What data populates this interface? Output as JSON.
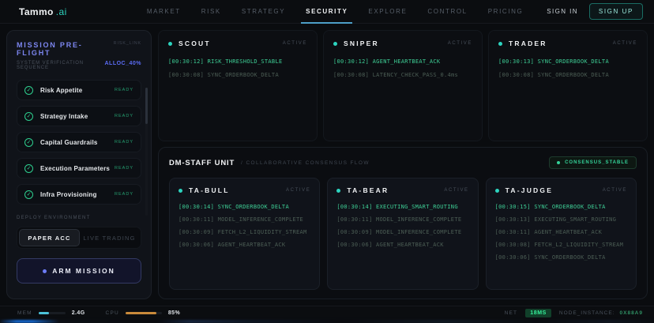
{
  "brand": {
    "name": "Tammo",
    "suffix": ".ai"
  },
  "nav": {
    "items": [
      {
        "label": "MARKET"
      },
      {
        "label": "RISK"
      },
      {
        "label": "STRATEGY"
      },
      {
        "label": "SECURITY",
        "active": true
      },
      {
        "label": "EXPLORE"
      },
      {
        "label": "CONTROL"
      },
      {
        "label": "PRICING"
      }
    ],
    "sign_in": "SIGN IN",
    "sign_up": "SIGN UP"
  },
  "sidebar": {
    "title": "MISSION PRE-FLIGHT",
    "risk_link": "RISK_LINK",
    "subtitle": "SYSTEM VERIFICATION SEQUENCE",
    "alloc": "ALLOC_40%",
    "check_glyph": "✓",
    "checklist": [
      {
        "label": "Risk Appetite",
        "status": "READY"
      },
      {
        "label": "Strategy Intake",
        "status": "READY"
      },
      {
        "label": "Capital Guardrails",
        "status": "READY"
      },
      {
        "label": "Execution Parameters",
        "status": "READY"
      },
      {
        "label": "Infra Provisioning",
        "status": "READY"
      }
    ],
    "deploy_label": "DEPLOY ENVIRONMENT",
    "env_options": [
      {
        "label": "PAPER ACC",
        "active": true
      },
      {
        "label": "LIVE TRADING",
        "active": false
      }
    ],
    "arm_button": "ARM MISSION"
  },
  "agents": [
    {
      "name": "SCOUT",
      "status": "ACTIVE",
      "logs": [
        {
          "time": "[00:30:12]",
          "msg": "RISK_THRESHOLD_STABLE"
        },
        {
          "time": "[00:30:08]",
          "msg": "SYNC_ORDERBOOK_DELTA"
        }
      ]
    },
    {
      "name": "SNIPER",
      "status": "ACTIVE",
      "logs": [
        {
          "time": "[00:30:12]",
          "msg": "AGENT_HEARTBEAT_ACK"
        },
        {
          "time": "[00:30:08]",
          "msg": "LATENCY_CHECK_PASS_0.4ms"
        }
      ]
    },
    {
      "name": "TRADER",
      "status": "ACTIVE",
      "logs": [
        {
          "time": "[00:30:13]",
          "msg": "SYNC_ORDERBOOK_DELTA"
        },
        {
          "time": "[00:30:08]",
          "msg": "SYNC_ORDERBOOK_DELTA"
        }
      ]
    }
  ],
  "staff_unit": {
    "title": "DM-STAFF UNIT",
    "subtitle": "/ COLLABORATIVE CONSENSUS FLOW",
    "badge": "CONSENSUS_STABLE",
    "agents": [
      {
        "name": "TA-BULL",
        "status": "ACTIVE",
        "logs": [
          {
            "time": "[00:30:14]",
            "msg": "SYNC_ORDERBOOK_DELTA"
          },
          {
            "time": "[00:30:11]",
            "msg": "MODEL_INFERENCE_COMPLETE"
          },
          {
            "time": "[00:30:09]",
            "msg": "FETCH_L2_LIQUIDITY_STREAM"
          },
          {
            "time": "[00:30:06]",
            "msg": "AGENT_HEARTBEAT_ACK"
          }
        ]
      },
      {
        "name": "TA-BEAR",
        "status": "ACTIVE",
        "logs": [
          {
            "time": "[00:30:14]",
            "msg": "EXECUTING_SMART_ROUTING"
          },
          {
            "time": "[00:30:11]",
            "msg": "MODEL_INFERENCE_COMPLETE"
          },
          {
            "time": "[00:30:09]",
            "msg": "MODEL_INFERENCE_COMPLETE"
          },
          {
            "time": "[00:30:06]",
            "msg": "AGENT_HEARTBEAT_ACK"
          }
        ]
      },
      {
        "name": "TA-JUDGE",
        "status": "ACTIVE",
        "logs": [
          {
            "time": "[00:30:15]",
            "msg": "SYNC_ORDERBOOK_DELTA"
          },
          {
            "time": "[00:30:13]",
            "msg": "EXECUTING_SMART_ROUTING"
          },
          {
            "time": "[00:30:11]",
            "msg": "AGENT_HEARTBEAT_ACK"
          },
          {
            "time": "[00:30:08]",
            "msg": "FETCH_L2_LIQUIDITY_STREAM"
          },
          {
            "time": "[00:30:06]",
            "msg": "SYNC_ORDERBOOK_DELTA"
          }
        ]
      }
    ]
  },
  "status_bar": {
    "mem_label": "MEM",
    "mem_value": "2.4G",
    "mem_pct": 38,
    "cpu_label": "CPU",
    "cpu_value": "85%",
    "cpu_pct": 85,
    "net_label": "NET",
    "net_value": "18MS",
    "node_label": "NODE_INSTANCE:",
    "node_value": "0X88A9"
  },
  "colors": {
    "accent_teal": "#2dd4bf",
    "accent_indigo": "#6d7cf5",
    "status_green": "#2ecf8f",
    "log_bright": "#3ecf96",
    "log_dim": "#4c5e55",
    "cpu_amber": "#c98a3b",
    "mem_cyan": "#4cc3d9",
    "nav_underline": "#4d9fc7"
  }
}
